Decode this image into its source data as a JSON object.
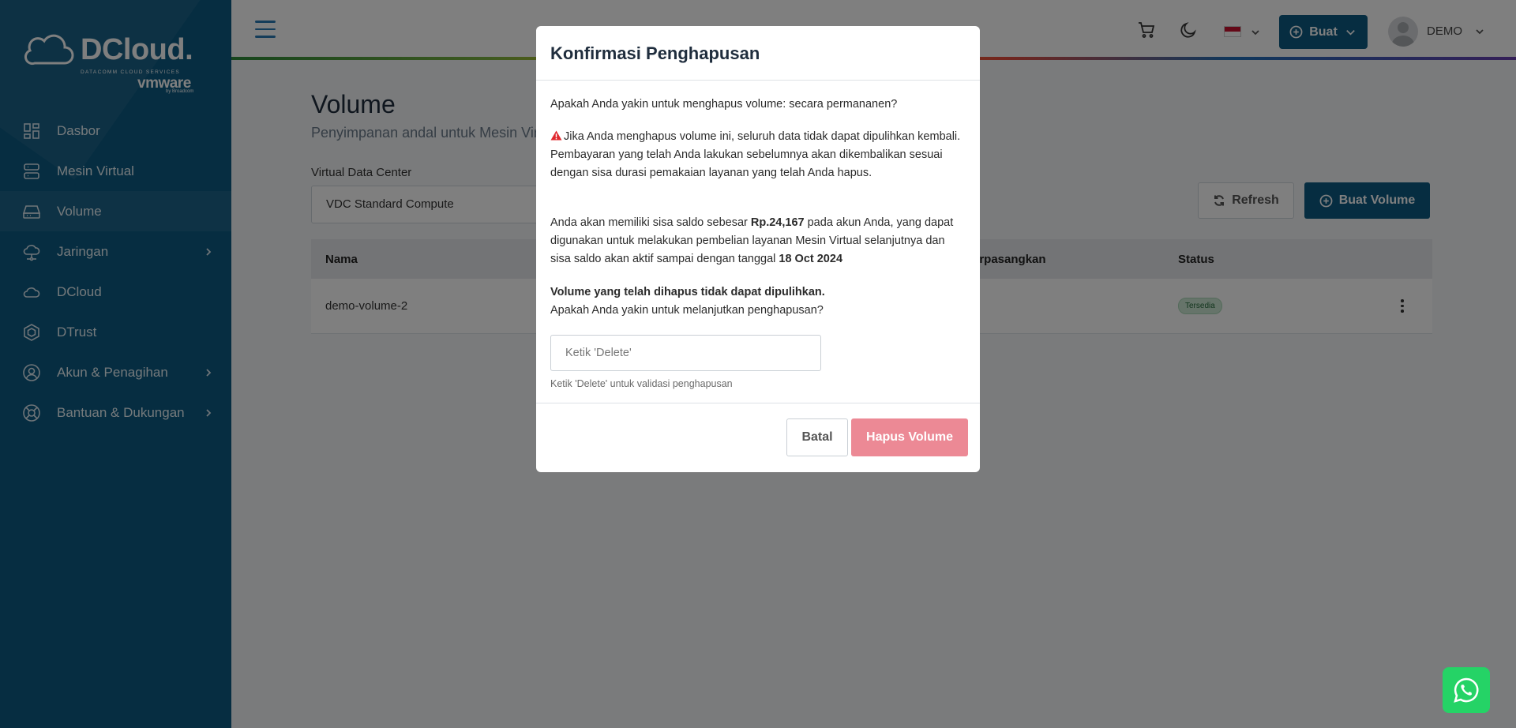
{
  "sidebar": {
    "logo": {
      "brand": "DCloud.",
      "tagline": "DATACOMM CLOUD SERVICES",
      "partner": "vmware",
      "partner_by": "by Broadcom"
    },
    "items": [
      {
        "label": "Dasbor",
        "icon": "dashboard-icon"
      },
      {
        "label": "Mesin Virtual",
        "icon": "server-icon"
      },
      {
        "label": "Volume",
        "icon": "drive-icon",
        "active": true
      },
      {
        "label": "Jaringan",
        "icon": "network-cloud-icon",
        "has_children": true
      },
      {
        "label": "DCloud",
        "icon": "cloud-icon"
      },
      {
        "label": "DTrust",
        "icon": "hexagon-shield-icon"
      },
      {
        "label": "Akun & Penagihan",
        "icon": "user-circle-icon",
        "has_children": true
      },
      {
        "label": "Bantuan & Dukungan",
        "icon": "lifebuoy-icon",
        "has_children": true
      }
    ]
  },
  "topbar": {
    "create_label": "Buat",
    "username": "DEMO",
    "language_flag": "id"
  },
  "main": {
    "title": "Volume",
    "subtitle": "Penyimpanan andal untuk Mesin Vir",
    "vdc_label": "Virtual Data Center",
    "vdc_value": "VDC Standard Compute",
    "refresh_label": "Refresh",
    "create_volume_label": "Buat Volume",
    "table": {
      "headers": {
        "name": "Nama",
        "attached": "erpasangkan",
        "status": "Status"
      },
      "rows": [
        {
          "name": "demo-volume-2",
          "status": "Tersedia"
        }
      ]
    }
  },
  "modal": {
    "title": "Konfirmasi Penghapusan",
    "question": "Apakah Anda yakin untuk menghapus volume: secara permananen?",
    "warning": "Jika Anda menghapus volume ini, seluruh data tidak dapat dipulihkan kembali. Pembayaran yang telah Anda lakukan sebelumnya akan dikembalikan sesuai dengan sisa durasi pemakaian layanan yang telah Anda hapus.",
    "saldo_pre": "Anda akan memiliki sisa saldo sebesar ",
    "saldo_amount": "Rp.24,167",
    "saldo_mid": " pada akun Anda, yang dapat digunakan untuk melakukan pembelian layanan Mesin Virtual selanjutnya dan sisa saldo akan aktif sampai dengan tanggal ",
    "saldo_date": "18 Oct 2024",
    "final_bold": "Volume yang telah dihapus tidak dapat dipulihkan.",
    "final_question": "Apakah Anda yakin untuk melanjutkan penghapusan?",
    "input_placeholder": "Ketik 'Delete'",
    "input_value": "",
    "helper": "Ketik 'Delete' untuk validasi penghapusan",
    "cancel_label": "Batal",
    "delete_label": "Hapus Volume"
  },
  "colors": {
    "sidebar_bg": "#0c5a82",
    "primary": "#0c5a82",
    "danger_disabled": "#ec8995",
    "success_badge": "#cde8d5",
    "whatsapp": "#25d366"
  }
}
